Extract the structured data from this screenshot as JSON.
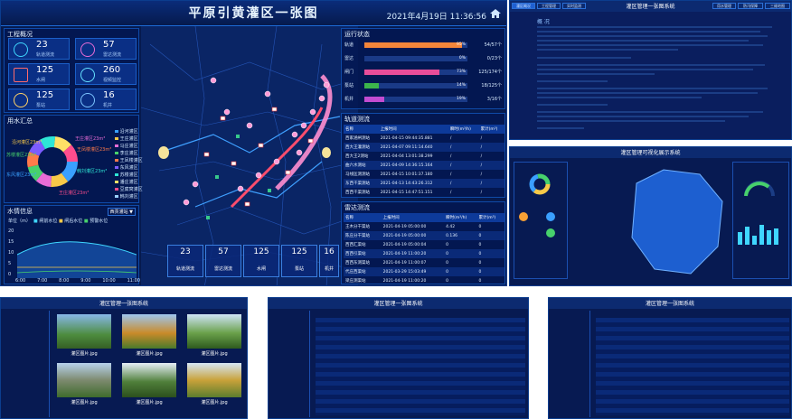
{
  "main": {
    "title": "平原引黄灌区一张图",
    "datetime": "2021年4月19日 11:36:56",
    "project_overview": {
      "title": "工程概况",
      "cards": [
        {
          "value": "23",
          "label": "轨道测流",
          "icon": "track-flow-icon"
        },
        {
          "value": "57",
          "label": "雷达测流",
          "icon": "radar-flow-icon"
        },
        {
          "value": "125",
          "label": "水闸",
          "icon": "sluice-icon"
        },
        {
          "value": "260",
          "label": "视频监控",
          "icon": "camera-icon"
        },
        {
          "value": "125",
          "label": "泵站",
          "icon": "pump-icon"
        },
        {
          "value": "16",
          "label": "机井",
          "icon": "well-icon"
        }
      ]
    },
    "water_use": {
      "title": "用水汇总",
      "legend": [
        "沿河灌区",
        "王庄灌区",
        "马庄灌区",
        "李庄灌区",
        "王凤楼灌区",
        "东风灌区",
        "苏楼灌区",
        "潘庄灌区",
        "豆腐窝灌区",
        "韩刘灌区"
      ],
      "labels": [
        "沿河灌区23m³",
        "王庄灌区23m³",
        "苏楼灌区23m³",
        "王凤楼灌区23m³",
        "东风灌区23m³",
        "韩刘灌区23m³",
        "王庄灌区23m³"
      ]
    },
    "water_level": {
      "title": "水情信息",
      "select": "西贾灌站 ▼",
      "legend": [
        "闸前水位",
        "闸后水位",
        "预警水位"
      ],
      "unit": "单位（m）",
      "y_ticks": [
        "20",
        "15",
        "10",
        "5",
        "0"
      ],
      "x_ticks": [
        "6:00",
        "7:00",
        "8:00",
        "9:00",
        "10:00",
        "11:00"
      ]
    },
    "running_status": {
      "title": "运行状态",
      "rows": [
        {
          "name": "轨道",
          "pct": "95%",
          "ratio": "54/57个",
          "fill": 0.95,
          "color": "#f4853a"
        },
        {
          "name": "雷达",
          "pct": "0%",
          "ratio": "0/23个",
          "fill": 0.0,
          "color": "#f4853a"
        },
        {
          "name": "闸门",
          "pct": "73%",
          "ratio": "125/174个",
          "fill": 0.73,
          "color": "#e84d9a"
        },
        {
          "name": "泵站",
          "pct": "14%",
          "ratio": "18/125个",
          "fill": 0.14,
          "color": "#3cb44b"
        },
        {
          "name": "机井",
          "pct": "19%",
          "ratio": "3/16个",
          "fill": 0.19,
          "color": "#c34cd1"
        }
      ]
    },
    "track_flow": {
      "title": "轨道测流",
      "headers": [
        "名称",
        "上报时间",
        "瞬时(m³/h)",
        "累计(m³)"
      ],
      "rows": [
        [
          "西家涵闸测站",
          "2021-04-15 09:44:35.881",
          "/",
          "/"
        ],
        [
          "西大王灌测站",
          "2021-04-07 09:11:14.640",
          "/",
          "/"
        ],
        [
          "西大王2测站",
          "2021-04-04 13:01:38.299",
          "/",
          "/"
        ],
        [
          "曲六水测站",
          "2021-04-09 14:36:15.164",
          "/",
          "/"
        ],
        [
          "马线匡测测站",
          "2021-04-15 10:01:37.180",
          "/",
          "/"
        ],
        [
          "东西干渠测站",
          "2021-04-13 14:43:26.312",
          "/",
          "/"
        ],
        [
          "西西干渠测站",
          "2021-04-15 14:47:51.151",
          "/",
          "/"
        ]
      ]
    },
    "radar_flow": {
      "title": "雷达测流",
      "headers": [
        "名称",
        "上报时间",
        "瞬时(m³/h)",
        "累计(m³)"
      ],
      "rows": [
        [
          "王木分干渠站",
          "2021-04-19 05:00:00",
          "4.42",
          "0"
        ],
        [
          "陈庄分干渠站",
          "2021-04-19 05:00:00",
          "0.136",
          "0"
        ],
        [
          "西西汇渠站",
          "2021-04-19 05:00:04",
          "0",
          "0"
        ],
        [
          "西西引渠站",
          "2021-04-19 11:00:20",
          "0",
          "0"
        ],
        [
          "西西东测渠站",
          "2021-04-19 11:00:07",
          "0",
          "0"
        ],
        [
          "代庄西渠站",
          "2021-03-29 15:03:49",
          "0",
          "0"
        ],
        [
          "梁庄测渠站",
          "2021-04-19 11:00:20",
          "0",
          "0"
        ]
      ]
    },
    "bottom_cards": [
      {
        "value": "23",
        "label": "轨道测流",
        "icon": "track-flow-icon"
      },
      {
        "value": "57",
        "label": "雷达测流",
        "icon": "radar-flow-icon"
      },
      {
        "value": "125",
        "label": "水闸",
        "icon": "sluice-icon"
      },
      {
        "value": "125",
        "label": "泵站",
        "icon": "pump-icon"
      },
      {
        "value": "16",
        "label": "机井",
        "icon": "well-icon"
      }
    ]
  },
  "thumb_doc": {
    "tabs": [
      "灌区概况",
      "工程管理",
      "实时监测",
      "用水管理",
      "防汛保障",
      "三维地图"
    ],
    "title": "灌区管理一张图系统",
    "heading": "概 况"
  },
  "thumb_dashboard": {
    "title": "灌区管理可视化展示系统"
  },
  "thumb_gallery": {
    "title": "灌区管理一张图系统",
    "captions": [
      "灌区图片.jpg",
      "灌区图片.jpg",
      "灌区图片.jpg",
      "灌区图片.jpg",
      "灌区图片.jpg",
      "灌区图片.jpg"
    ]
  },
  "thumb_table1": {
    "title": "灌区管理一张图系统"
  },
  "thumb_table2": {
    "title": "灌区管理一张图系统"
  }
}
